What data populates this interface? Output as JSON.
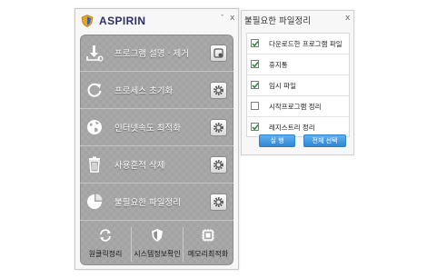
{
  "main_window": {
    "title": "ASPIRIN",
    "minimize_label": "-",
    "close_label": "x",
    "menu": [
      {
        "label": "프로그램 설명 · 제거",
        "icon": "download-icon"
      },
      {
        "label": "프로세스 초기화",
        "icon": "refresh-icon"
      },
      {
        "label": "인터넷속도 최적화",
        "icon": "globe-icon"
      },
      {
        "label": "사용흔적 삭제",
        "icon": "trash-icon"
      },
      {
        "label": "불필요한 파일정리",
        "icon": "pie-chart-icon"
      }
    ],
    "bottom": [
      {
        "label": "원클릭정리",
        "icon": "sync-icon"
      },
      {
        "label": "시스템정보확인",
        "icon": "shield-icon"
      },
      {
        "label": "메모리최적화",
        "icon": "chip-icon"
      }
    ]
  },
  "popup": {
    "title": "불필요한 파일정리",
    "close_label": "x",
    "items": [
      {
        "label": "다운로드한 프로그램 파일",
        "checked": true
      },
      {
        "label": "휴지통",
        "checked": true
      },
      {
        "label": "임시 파일",
        "checked": true
      },
      {
        "label": "시작프로그램 정리",
        "checked": false
      },
      {
        "label": "레지스트리 정리",
        "checked": true
      }
    ],
    "run_label": "실 행",
    "select_all_label": "전체 선택"
  },
  "colors": {
    "accent_blue": "#2f86d2",
    "title_navy": "#2c2f66",
    "panel_gray": "#a9a9a9",
    "checkmark_green": "#2d8a3a"
  }
}
